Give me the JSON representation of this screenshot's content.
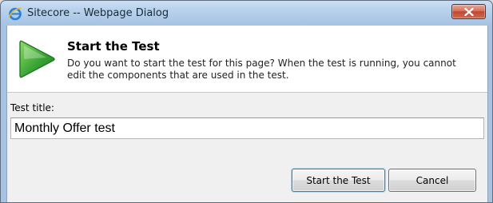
{
  "window": {
    "title": "Sitecore -- Webpage Dialog",
    "icons": {
      "app": "internet-explorer-icon",
      "close": "close-icon"
    },
    "colors": {
      "frame": "#a9c5e4",
      "close_button": "#c2472f"
    }
  },
  "header": {
    "icon": "play-icon",
    "icon_color": "#3aa534",
    "title": "Start the Test",
    "description": "Do you want to start the test for this page? When the test is running, you cannot edit the components that are used in the test."
  },
  "form": {
    "test_title_label": "Test title:",
    "test_title_value": "Monthly Offer test"
  },
  "buttons": {
    "start_label": "Start the Test",
    "cancel_label": "Cancel"
  }
}
